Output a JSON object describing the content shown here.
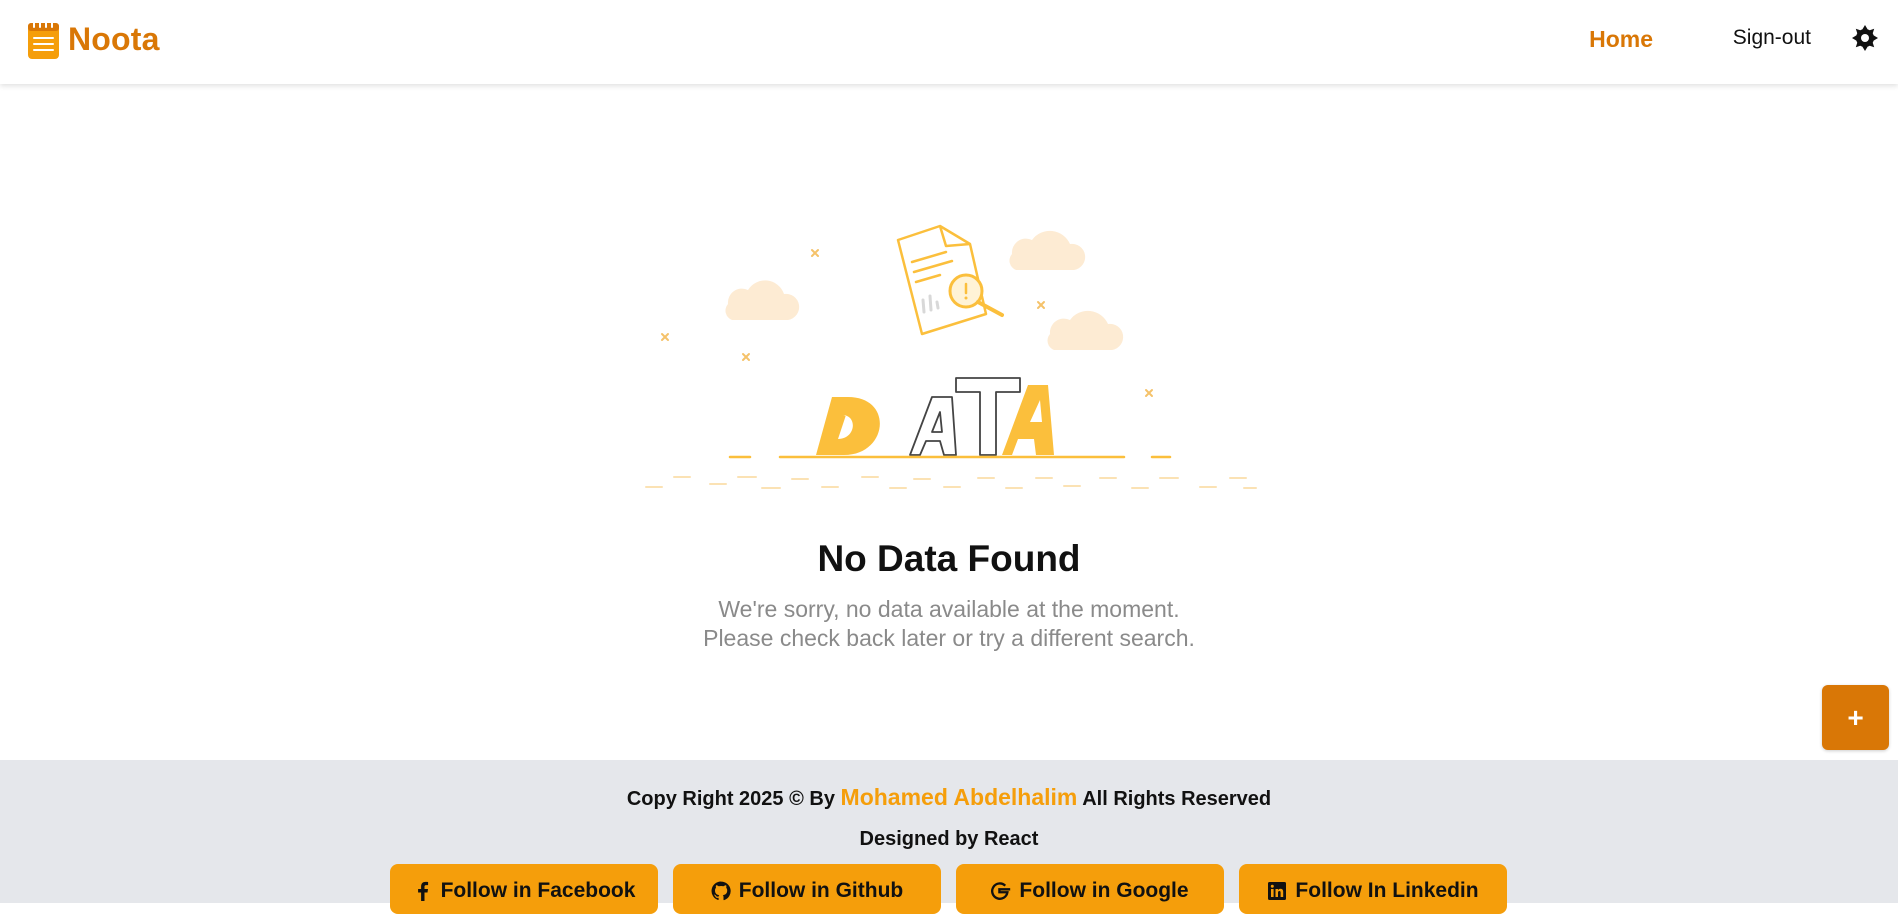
{
  "navbar": {
    "brand": "Noota",
    "links": {
      "home": "Home",
      "signout": "Sign-out"
    },
    "theme_icon": "sun-icon"
  },
  "empty_state": {
    "illustration_text": "DATA",
    "title": "No Data Found",
    "subtitle_line1": "We're sorry, no data available at the moment.",
    "subtitle_line2": "Please check back later or try a different search."
  },
  "fab": {
    "label": "+"
  },
  "footer": {
    "copyright_prefix": "Copy Right 2025 © By",
    "author": "Mohamed Abdelhalim",
    "copyright_suffix": "All Rights Reserved",
    "designed_by": "Designed by React",
    "social": [
      {
        "label": "Follow in Facebook",
        "icon": "facebook-icon"
      },
      {
        "label": "Follow in Github",
        "icon": "github-icon"
      },
      {
        "label": "Follow in Google",
        "icon": "google-icon"
      },
      {
        "label": "Follow In Linkedin",
        "icon": "linkedin-icon"
      }
    ]
  },
  "colors": {
    "accent": "#d97706",
    "button": "#f59e0b",
    "footer_bg": "#e5e7eb",
    "illustration": "#fbbf3c",
    "cloud": "#fdebd3"
  }
}
